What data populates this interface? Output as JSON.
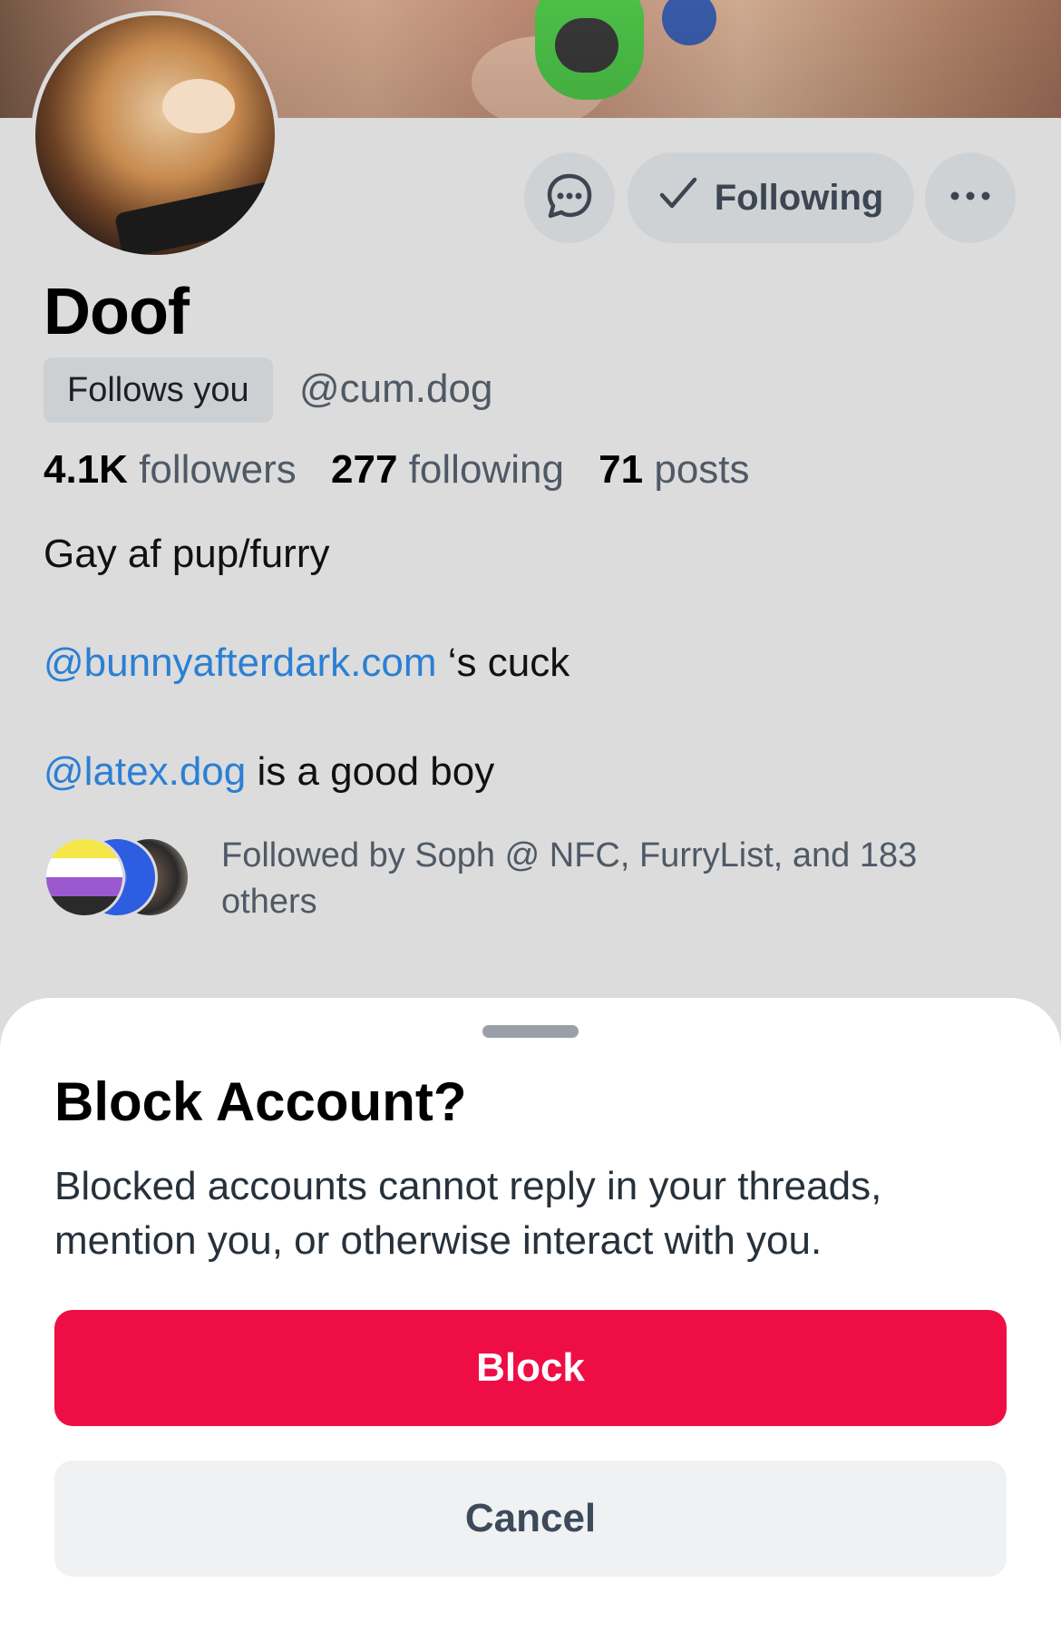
{
  "profile": {
    "display_name": "Doof",
    "follows_you_badge": "Follows you",
    "handle": "@cum.dog",
    "stats": {
      "followers_count": "4.1K",
      "followers_label": "followers",
      "following_count": "277",
      "following_label": "following",
      "posts_count": "71",
      "posts_label": "posts"
    },
    "bio": {
      "line1": "Gay af pup/furry",
      "line2_link": "@bunnyafterdark.com",
      "line2_text": " ‘s cuck",
      "line3_link": "@latex.dog",
      "line3_text": " is a good boy"
    },
    "followed_by_text": "Followed by Soph @ NFC, FurryList, and 183 others",
    "actions": {
      "message_icon": "chat-bubble-icon",
      "following_label": "Following",
      "following_icon": "checkmark-icon",
      "more_icon": "ellipsis-icon"
    }
  },
  "block_sheet": {
    "title": "Block Account?",
    "message": "Blocked accounts cannot reply in your threads, mention you, or otherwise interact with you.",
    "block_label": "Block",
    "cancel_label": "Cancel"
  },
  "colors": {
    "block_red": "#ee0e45",
    "link_blue": "#2b7fd4",
    "overlay_gray": "#dcdcdc"
  }
}
